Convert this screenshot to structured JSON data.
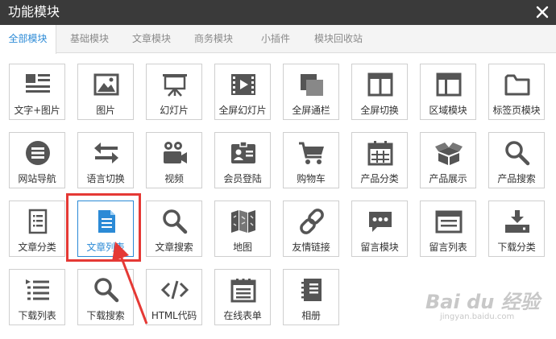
{
  "window": {
    "title": "功能模块",
    "close_icon": "close-icon"
  },
  "tabs": [
    {
      "label": "全部模块",
      "active": true
    },
    {
      "label": "基础模块",
      "active": false
    },
    {
      "label": "文章模块",
      "active": false
    },
    {
      "label": "商务模块",
      "active": false
    },
    {
      "label": "小插件",
      "active": false
    },
    {
      "label": "模块回收站",
      "active": false
    }
  ],
  "modules": [
    {
      "label": "文字+图片",
      "icon": "text-image-icon"
    },
    {
      "label": "图片",
      "icon": "image-icon"
    },
    {
      "label": "幻灯片",
      "icon": "slideshow-easel-icon"
    },
    {
      "label": "全屏幻灯片",
      "icon": "fullscreen-slideshow-icon"
    },
    {
      "label": "全屏通栏",
      "icon": "fullscreen-banner-icon"
    },
    {
      "label": "全屏切换",
      "icon": "fullscreen-switch-icon"
    },
    {
      "label": "区域模块",
      "icon": "region-module-icon"
    },
    {
      "label": "标签页模块",
      "icon": "folder-tab-icon"
    },
    {
      "label": "网站导航",
      "icon": "menu-list-icon"
    },
    {
      "label": "语言切换",
      "icon": "language-switch-arrows-icon"
    },
    {
      "label": "视频",
      "icon": "video-camera-icon"
    },
    {
      "label": "会员登陆",
      "icon": "member-card-icon"
    },
    {
      "label": "购物车",
      "icon": "shopping-cart-icon"
    },
    {
      "label": "产品分类",
      "icon": "calendar-grid-icon"
    },
    {
      "label": "产品展示",
      "icon": "product-box-icon"
    },
    {
      "label": "产品搜索",
      "icon": "search-icon"
    },
    {
      "label": "文章分类",
      "icon": "article-category-icon"
    },
    {
      "label": "文章列表",
      "icon": "document-icon",
      "selected": true
    },
    {
      "label": "文章搜索",
      "icon": "search-icon"
    },
    {
      "label": "地图",
      "icon": "map-icon"
    },
    {
      "label": "友情链接",
      "icon": "link-chain-icon"
    },
    {
      "label": "留言模块",
      "icon": "chat-bubble-icon"
    },
    {
      "label": "留言列表",
      "icon": "message-list-icon"
    },
    {
      "label": "下载分类",
      "icon": "download-tray-icon"
    },
    {
      "label": "下载列表",
      "icon": "download-list-icon"
    },
    {
      "label": "下载搜索",
      "icon": "search-icon"
    },
    {
      "label": "HTML代码",
      "icon": "code-brackets-icon"
    },
    {
      "label": "在线表单",
      "icon": "online-form-icon"
    },
    {
      "label": "相册",
      "icon": "album-notebook-icon"
    }
  ],
  "colors": {
    "titlebar": "#3a3a3a",
    "accent": "#2b8ad6",
    "icon": "#555555",
    "highlight": "#e53935",
    "tile_border": "#cfcfcf"
  },
  "watermark": {
    "main": "Bai du 经验",
    "sub": "jingyan.baidu.com"
  }
}
